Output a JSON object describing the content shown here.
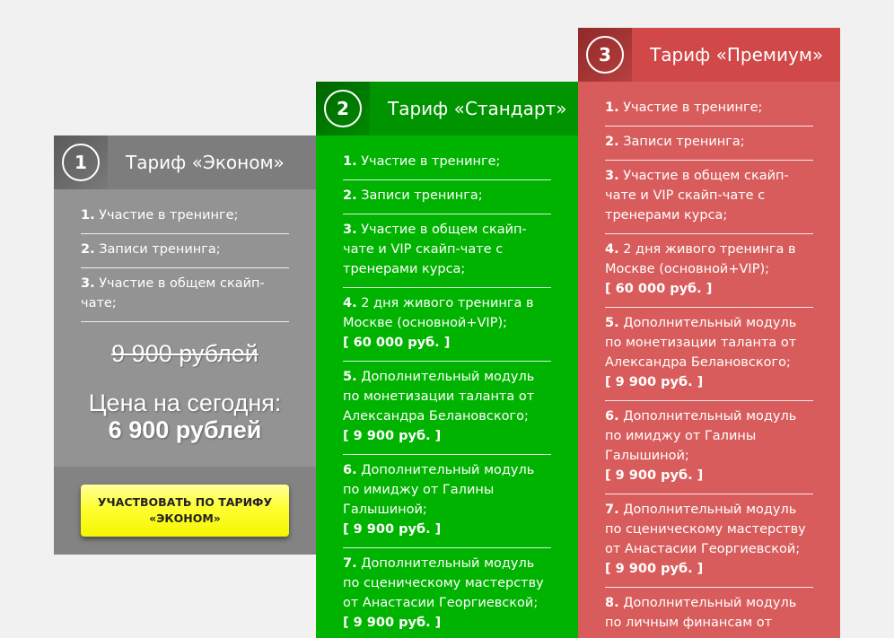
{
  "plans": [
    {
      "number": "1",
      "title": "Тариф «Эконом»",
      "items": [
        {
          "n": "1.",
          "text": " Участие в тренинге;"
        },
        {
          "n": "2.",
          "text": " Записи тренинга;"
        },
        {
          "n": "3.",
          "text": " Участие в общем скайп-чате;"
        }
      ],
      "old_price": "9 900 рублей",
      "today_label": "Цена на сегодня:",
      "today_price": "6 900 рублей",
      "cta_line1": "УЧАСТВОВАТЬ ПО ТАРИФУ",
      "cta_line2": "«ЭКОНОМ»"
    },
    {
      "number": "2",
      "title": "Тариф «Стандарт»",
      "items": [
        {
          "n": "1.",
          "text": " Участие в тренинге;"
        },
        {
          "n": "2.",
          "text": " Записи тренинга;"
        },
        {
          "n": "3.",
          "text": " Участие в общем скайп-чате и VIP скайп-чате с тренерами курса;"
        },
        {
          "n": "4.",
          "text": " 2 дня живого тренинга в Москве (основной+VIP);",
          "price": "[ 60 000 руб. ]"
        },
        {
          "n": "5.",
          "text": " Дополнительный модуль по монетизации таланта от Александра Белановского;",
          "price": "[ 9 900 руб. ]"
        },
        {
          "n": "6.",
          "text": " Дополнительный модуль по имиджу от Галины Галышиной;",
          "price": "[ 9 900 руб. ]"
        },
        {
          "n": "7.",
          "text": " Дополнительный модуль по сценическому мастерству от Анастасии Георгиевской;",
          "price": "[ 9 900 руб. ]"
        }
      ]
    },
    {
      "number": "3",
      "title": "Тариф «Премиум»",
      "items": [
        {
          "n": "1.",
          "text": " Участие в тренинге;"
        },
        {
          "n": "2.",
          "text": " Записи тренинга;"
        },
        {
          "n": "3.",
          "text": " Участие в общем скайп-чате и VIP скайп-чате с тренерами курса;"
        },
        {
          "n": "4.",
          "text": " 2 дня живого тренинга в Москве (основной+VIP);",
          "price": "[ 60 000 руб. ]"
        },
        {
          "n": "5.",
          "text": " Дополнительный модуль по монетизации таланта от Александра Белановского;",
          "price": "[ 9 900 руб. ]"
        },
        {
          "n": "6.",
          "text": " Дополнительный модуль по имиджу от Галины Галышиной;",
          "price": "[ 9 900 руб. ]"
        },
        {
          "n": "7.",
          "text": " Дополнительный модуль по сценическому мастерству от Анастасии Георгиевской;",
          "price": "[ 9 900 руб. ]"
        },
        {
          "n": "8.",
          "text": " Дополнительный модуль по личным финансам от"
        }
      ]
    }
  ],
  "colors": {
    "econom": "#939393",
    "standard": "#00b300",
    "premium": "#d95c5c",
    "cta": "#ffff33"
  }
}
